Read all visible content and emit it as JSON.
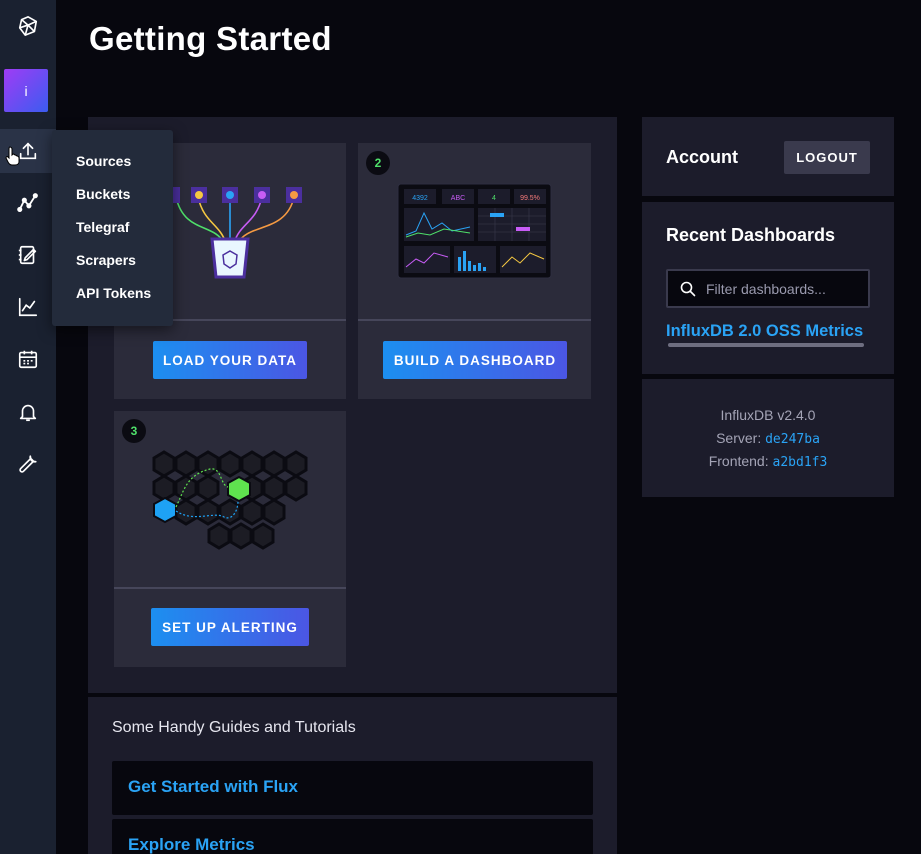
{
  "sidebar": {
    "org_initial": "i",
    "items": [
      {
        "icon": "influxdb-logo-icon"
      },
      {
        "icon": "upload-data-icon"
      },
      {
        "icon": "data-explorer-icon"
      },
      {
        "icon": "notebooks-icon"
      },
      {
        "icon": "dashboards-icon"
      },
      {
        "icon": "tasks-icon"
      },
      {
        "icon": "alerts-bell-icon"
      },
      {
        "icon": "settings-wrench-icon"
      }
    ]
  },
  "flyout": {
    "items": [
      "Sources",
      "Buckets",
      "Telegraf",
      "Scrapers",
      "API Tokens"
    ]
  },
  "header": {
    "title": "Getting Started"
  },
  "cards": {
    "load": {
      "button": "LOAD YOUR DATA"
    },
    "dashboard": {
      "step": "2",
      "button": "BUILD A DASHBOARD",
      "mock_stats": [
        "4392",
        "ABC",
        "4",
        "99.5%"
      ]
    },
    "alerting": {
      "step": "3",
      "button": "SET UP ALERTING"
    }
  },
  "account": {
    "title": "Account",
    "logout": "LOGOUT"
  },
  "recent": {
    "title": "Recent Dashboards",
    "search_placeholder": "Filter dashboards...",
    "dashboards": [
      "InfluxDB 2.0 OSS Metrics"
    ]
  },
  "version": {
    "product": "InfluxDB v2.4.0",
    "server_label": "Server:",
    "server_value": "de247ba",
    "frontend_label": "Frontend:",
    "frontend_value": "a2bd1f3"
  },
  "guides": {
    "title": "Some Handy Guides and Tutorials",
    "items": [
      "Get Started with Flux",
      "Explore Metrics"
    ]
  },
  "colors": {
    "accent_blue": "#2aa3f5",
    "button_gradient_start": "#1c8ff0",
    "button_gradient_end": "#4b56e4",
    "step_green": "#4fe06a",
    "sidebar_bg": "#1a2130"
  }
}
